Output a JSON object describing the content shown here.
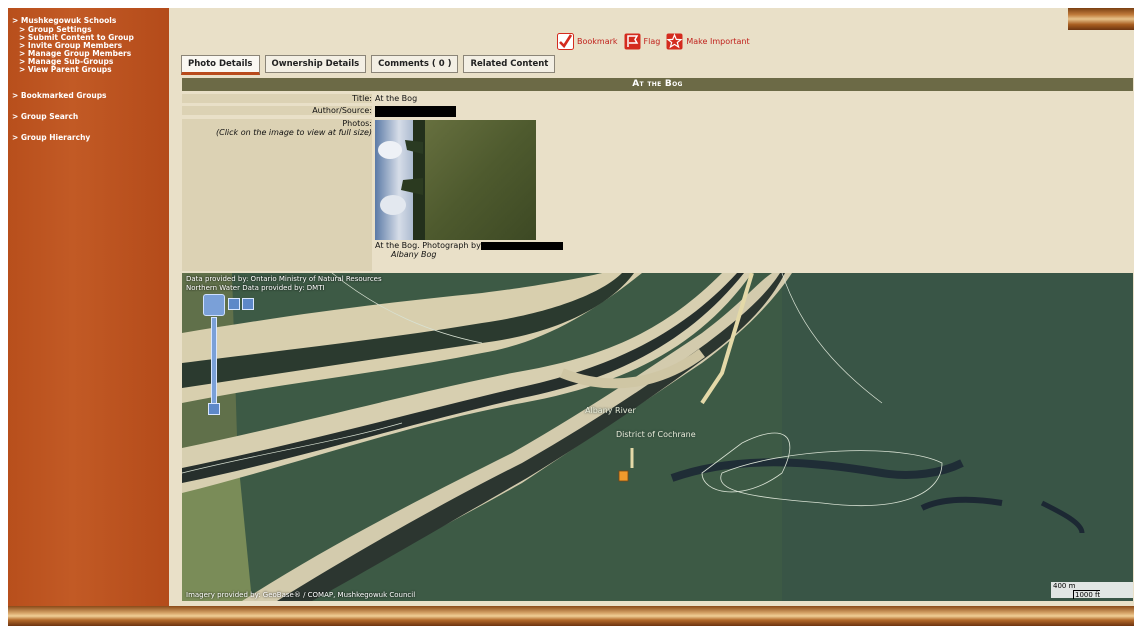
{
  "sidebar": {
    "group": "Mushkegowuk Schools",
    "group_links": [
      "Group Settings",
      "Submit Content to Group",
      "Invite Group Members",
      "Manage Group Members",
      "Manage Sub-Groups",
      "View Parent Groups"
    ],
    "sections": [
      "Bookmarked Groups",
      "Group Search",
      "Group Hierarchy"
    ]
  },
  "actions": {
    "bookmark": "Bookmark",
    "flag": "Flag",
    "important": "Make Important"
  },
  "tabs": [
    "Photo Details",
    "Ownership Details",
    "Comments ( 0 )",
    "Related Content"
  ],
  "details": {
    "header": "At the Bog",
    "title_label": "Title:",
    "title_value": "At the Bog",
    "author_label": "Author/Source:",
    "photos_label": "Photos:",
    "photos_hint": "(Click on the image to view at full size)",
    "caption": "At the Bog. Photograph by",
    "caption_place": "Albany Bog"
  },
  "map": {
    "attribution_top_1": "Data provided by: Ontario Ministry of Natural Resources",
    "attribution_top_2": "Northern Water Data provided by: DMTI",
    "label_river": "Albany River",
    "label_district": "District of Cochrane",
    "attribution_bottom": "Imagery provided by: GeoBase® / COMAP, Mushkegowuk Council",
    "scale_m": "400 m",
    "scale_ft": "1000 ft"
  }
}
